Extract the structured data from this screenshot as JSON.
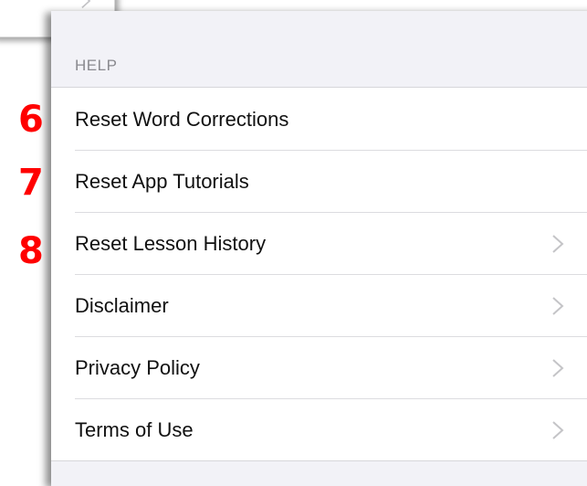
{
  "help_section": {
    "header": "HELP",
    "items": [
      {
        "label": "Reset Word Corrections",
        "has_chevron": false
      },
      {
        "label": "Reset App Tutorials",
        "has_chevron": false
      },
      {
        "label": "Reset Lesson History",
        "has_chevron": true
      },
      {
        "label": "Disclaimer",
        "has_chevron": true
      },
      {
        "label": "Privacy Policy",
        "has_chevron": true
      },
      {
        "label": "Terms of Use",
        "has_chevron": true
      }
    ]
  },
  "annotations": {
    "step_6": "6",
    "step_7": "7",
    "step_8": "8",
    "color": "#ff0000"
  },
  "icons": {
    "chevron": "chevron-right-icon"
  }
}
